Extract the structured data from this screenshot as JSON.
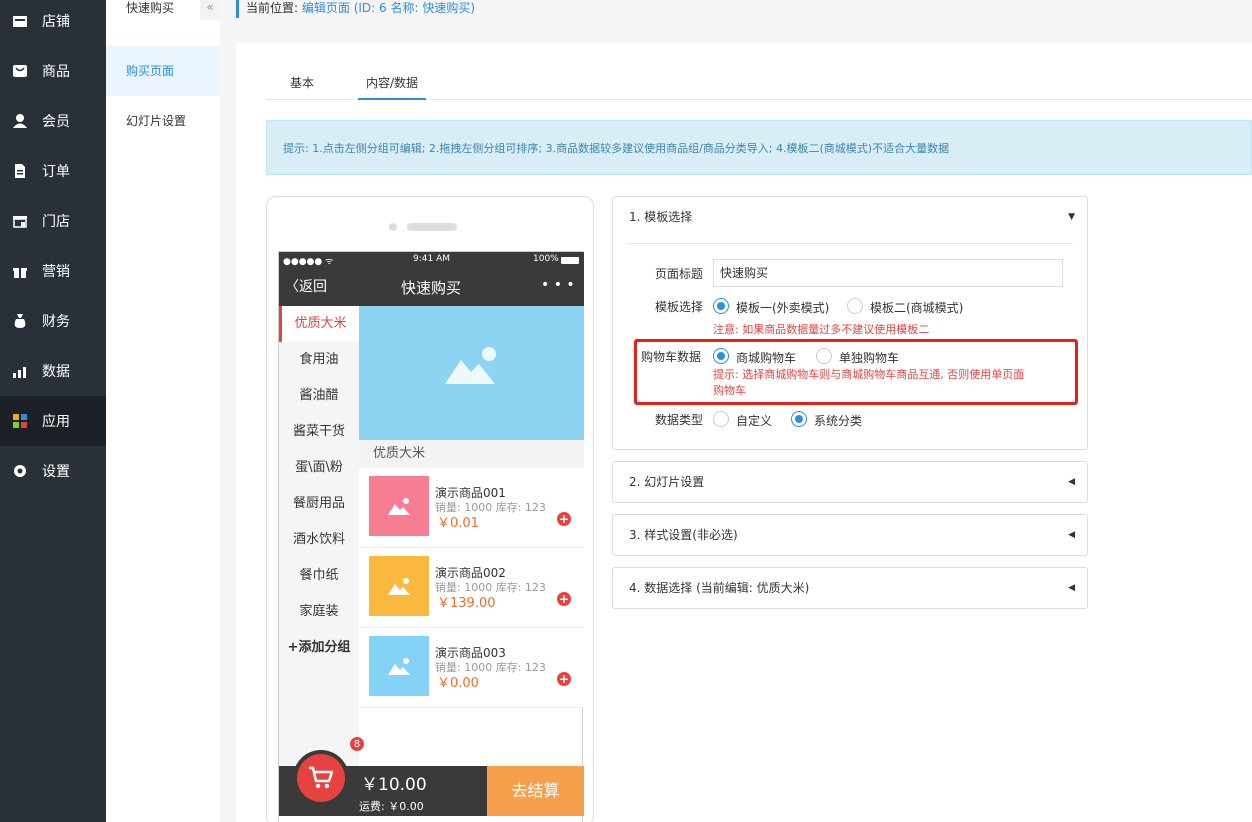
{
  "sidebar": {
    "items": [
      {
        "label": "店铺",
        "icon": "store-icon"
      },
      {
        "label": "商品",
        "icon": "goods-icon"
      },
      {
        "label": "会员",
        "icon": "user-icon"
      },
      {
        "label": "订单",
        "icon": "order-icon"
      },
      {
        "label": "门店",
        "icon": "shop-icon"
      },
      {
        "label": "营销",
        "icon": "gift-icon"
      },
      {
        "label": "财务",
        "icon": "finance-icon"
      },
      {
        "label": "数据",
        "icon": "chart-icon"
      },
      {
        "label": "应用",
        "icon": "apps-icon"
      },
      {
        "label": "设置",
        "icon": "gear-icon"
      }
    ]
  },
  "subnav": {
    "title": "快速购买",
    "collapse_glyph": "«",
    "items": [
      "购买页面",
      "幻灯片设置"
    ]
  },
  "breadcrumb": {
    "label": "当前位置:",
    "value": "编辑页面 (ID: 6 名称: 快速购买)"
  },
  "tabs": [
    "基本",
    "内容/数据"
  ],
  "tip": "提示: 1.点击左侧分组可编辑; 2.拖拽左侧分组可排序; 3.商品数据较多建议使用商品组/商品分类导入; 4.模板二(商城模式)不适合大量数据",
  "phone": {
    "status": {
      "signal": "●●●●● ᯤ",
      "time": "9:41 AM",
      "battery": "100%"
    },
    "back": "返回",
    "title": "快速购买",
    "more": "• • •",
    "categories": [
      "优质大米",
      "食用油",
      "酱油醋",
      "酱菜干货",
      "蛋\\面\\粉",
      "餐厨用品",
      "酒水饮料",
      "餐巾纸",
      "家庭装",
      "+添加分组"
    ],
    "section_title": "优质大米",
    "products": [
      {
        "name": "演示商品001",
        "meta": "销量: 1000 库存: 123",
        "price": "￥0.01",
        "color": "#f77d93"
      },
      {
        "name": "演示商品002",
        "meta": "销量: 1000 库存: 123",
        "price": "￥139.00",
        "color": "#f9b93e"
      },
      {
        "name": "演示商品003",
        "meta": "销量: 1000 库存: 123",
        "price": "￥0.00",
        "color": "#84d3f6"
      }
    ],
    "plus": "+",
    "cart_badge": "8",
    "total": "￥10.00",
    "shipping": "运费: ￥0.00",
    "checkout": "去结算"
  },
  "panels": {
    "p1": {
      "title": "1. 模板选择",
      "page_title_label": "页面标题",
      "page_title_value": "快速购买",
      "template_label": "模板选择",
      "template_opt1": "模板一(外卖模式)",
      "template_opt2": "模板二(商城模式)",
      "template_warn": "注意: 如果商品数据量过多不建议使用模板二",
      "cart_label": "购物车数据",
      "cart_opt1": "商城购物车",
      "cart_opt2": "单独购物车",
      "cart_hint1": "提示: 选择商城购物车则与商城购物车商品互通, 否则使用单页面",
      "cart_hint2": "购物车",
      "data_label": "数据类型",
      "data_opt1": "自定义",
      "data_opt2": "系统分类"
    },
    "p2": "2. 幻灯片设置",
    "p3": "3. 样式设置(非必选)",
    "p4": "4. 数据选择 (当前编辑: 优质大米)"
  },
  "colors": {
    "accent": "#2b8fe3",
    "warning": "#e64340",
    "sidebar": "#293038"
  }
}
